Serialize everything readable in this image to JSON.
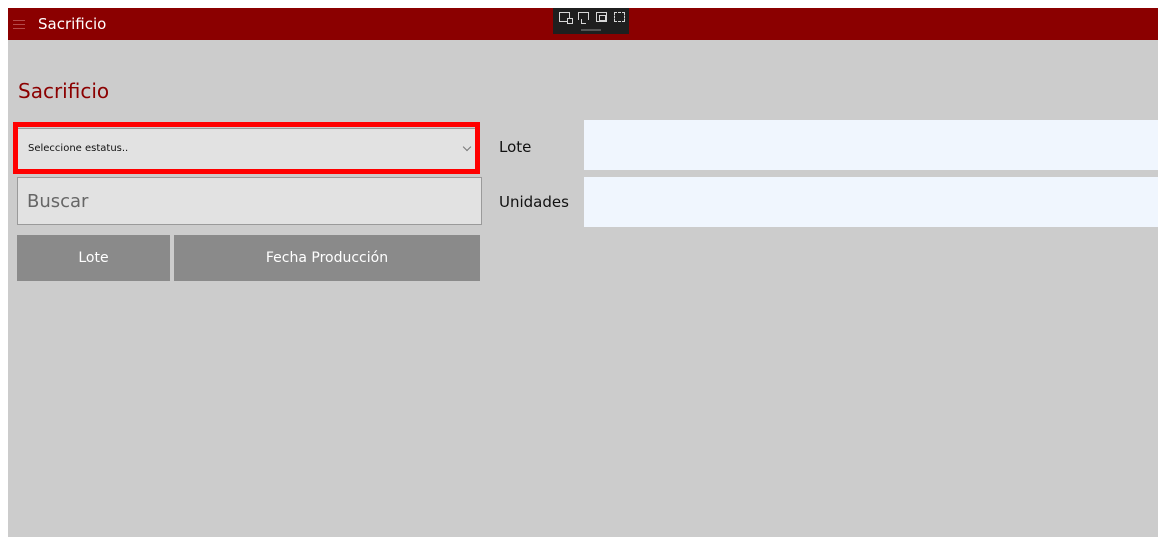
{
  "titlebar": {
    "title": "Sacrificio",
    "menu_icon": "hamburger-icon"
  },
  "debug_toolbar": {
    "icons": [
      "select-element-icon",
      "display-layout-adorners-icon",
      "track-focused-element-icon",
      "toggle-preview-icon"
    ]
  },
  "page": {
    "heading": "Sacrificio"
  },
  "status_select": {
    "placeholder": "Seleccione estatus..",
    "icon": "chevron-down-icon"
  },
  "search": {
    "placeholder": "Buscar",
    "value": ""
  },
  "sort_buttons": {
    "lote_label": "Lote",
    "fecha_label": "Fecha Producción"
  },
  "fields": {
    "lote_label": "Lote",
    "lote_value": "",
    "unidades_label": "Unidades",
    "unidades_value": ""
  },
  "colors": {
    "titlebar": "#8b0000",
    "heading": "#8b0000",
    "background": "#cccccc",
    "highlight": "#ff0000",
    "button": "#8a8a8a",
    "field": "#f0f6fe"
  }
}
